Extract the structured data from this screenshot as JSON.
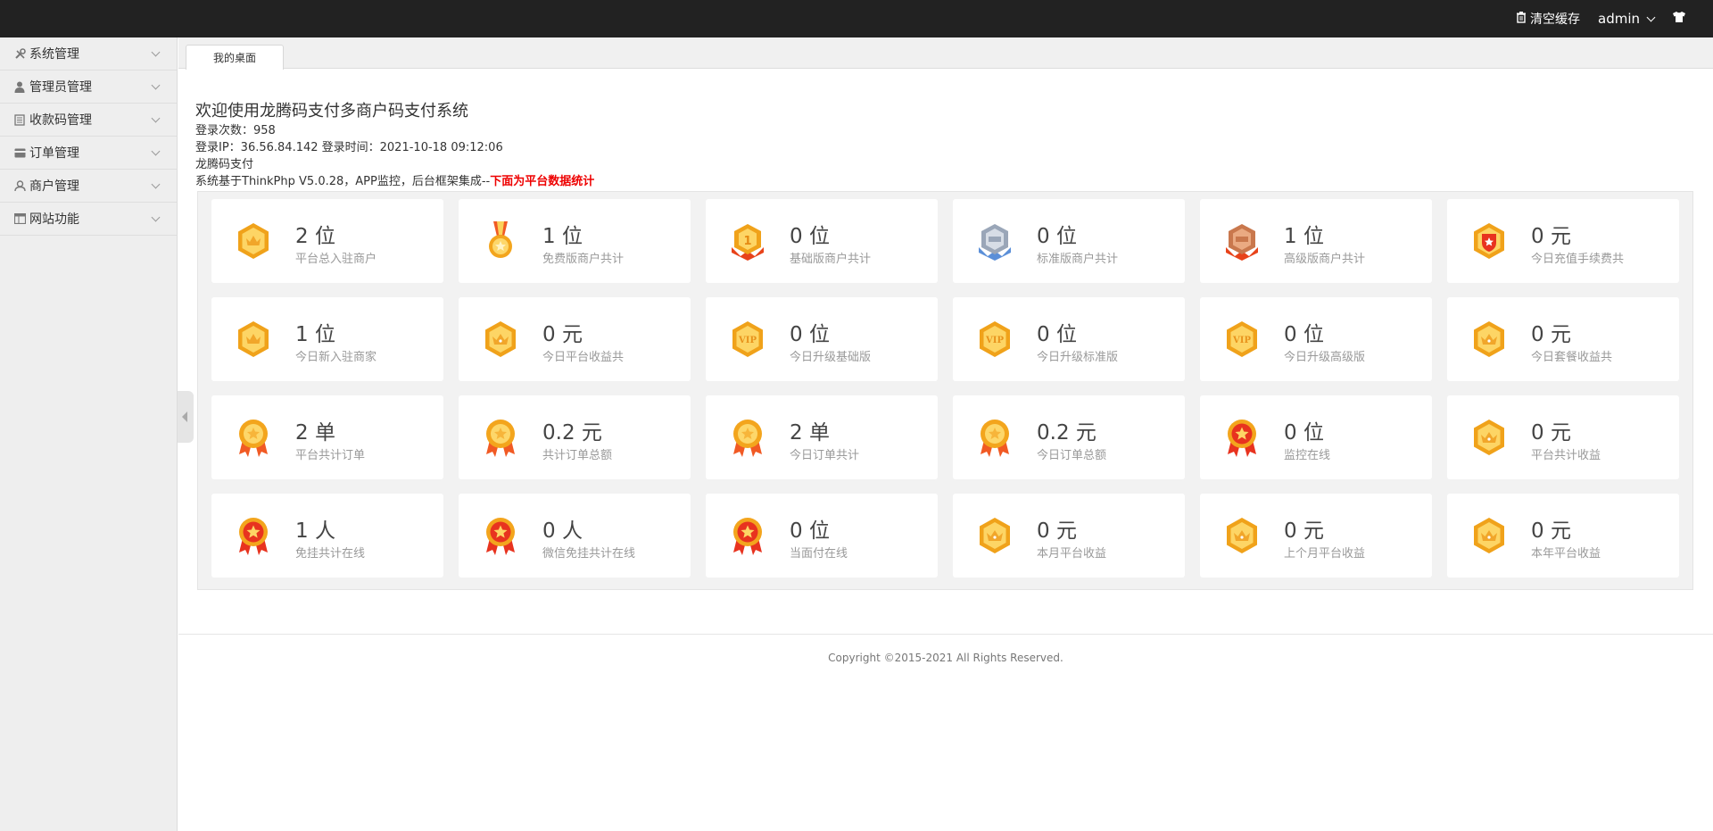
{
  "topbar": {
    "clear_cache_label": "清空缓存",
    "user_label": "admin"
  },
  "sidebar": {
    "items": [
      {
        "label": "系统管理",
        "icon": "wrench-icon"
      },
      {
        "label": "管理员管理",
        "icon": "user-icon"
      },
      {
        "label": "收款码管理",
        "icon": "document-icon"
      },
      {
        "label": "订单管理",
        "icon": "card-icon"
      },
      {
        "label": "商户管理",
        "icon": "merchant-icon"
      },
      {
        "label": "网站功能",
        "icon": "window-icon"
      }
    ]
  },
  "tabs": [
    {
      "label": "我的桌面"
    }
  ],
  "welcome": {
    "title": "欢迎使用龙腾码支付多商户码支付系统",
    "login_count": "登录次数：958",
    "login_info": "登录IP：36.56.84.142 登录时间：2021-10-18 09:12:06",
    "brand": "龙腾码支付",
    "framework_prefix": "系统基于ThinkPhp V5.0.28，APP监控，后台框架集成--",
    "framework_highlight": "下面为平台数据统计"
  },
  "stats": [
    {
      "value": "2 位",
      "label": "平台总入驻商户",
      "icon": "gold-hexagon-medal-icon"
    },
    {
      "value": "1 位",
      "label": "免费版商户共计",
      "icon": "ribbon-medal-icon"
    },
    {
      "value": "0 位",
      "label": "基础版商户共计",
      "icon": "gold-rank-badge-icon"
    },
    {
      "value": "0 位",
      "label": "标准版商户共计",
      "icon": "silver-rank-badge-icon"
    },
    {
      "value": "1 位",
      "label": "高级版商户共计",
      "icon": "bronze-rank-badge-icon"
    },
    {
      "value": "0 元",
      "label": "今日充值手续费共",
      "icon": "red-shield-medal-icon"
    },
    {
      "value": "1 位",
      "label": "今日新入驻商家",
      "icon": "gold-hexagon-medal-icon"
    },
    {
      "value": "0 元",
      "label": "今日平台收益共",
      "icon": "crown-hexagon-medal-icon"
    },
    {
      "value": "0 位",
      "label": "今日升级基础版",
      "icon": "vip-hexagon-icon"
    },
    {
      "value": "0 位",
      "label": "今日升级标准版",
      "icon": "vip-hexagon-icon"
    },
    {
      "value": "0 位",
      "label": "今日升级高级版",
      "icon": "vip-hexagon-icon"
    },
    {
      "value": "0 元",
      "label": "今日套餐收益共",
      "icon": "crown-hexagon-medal-icon"
    },
    {
      "value": "2 单",
      "label": "平台共计订单",
      "icon": "gold-rosette-icon"
    },
    {
      "value": "0.2 元",
      "label": "共计订单总额",
      "icon": "gold-rosette-icon"
    },
    {
      "value": "2 单",
      "label": "今日订单共计",
      "icon": "gold-rosette-icon"
    },
    {
      "value": "0.2 元",
      "label": "今日订单总额",
      "icon": "gold-rosette-icon"
    },
    {
      "value": "0 位",
      "label": "监控在线",
      "icon": "red-star-rosette-icon"
    },
    {
      "value": "0 元",
      "label": "平台共计收益",
      "icon": "crown-hexagon-medal-icon"
    },
    {
      "value": "1 人",
      "label": "免挂共计在线",
      "icon": "red-star-rosette-icon"
    },
    {
      "value": "0 人",
      "label": "微信免挂共计在线",
      "icon": "red-star-rosette-icon"
    },
    {
      "value": "0 位",
      "label": "当面付在线",
      "icon": "red-star-rosette-icon"
    },
    {
      "value": "0 元",
      "label": "本月平台收益",
      "icon": "crown-hexagon-medal-icon"
    },
    {
      "value": "0 元",
      "label": "上个月平台收益",
      "icon": "crown-hexagon-medal-icon"
    },
    {
      "value": "0 元",
      "label": "本年平台收益",
      "icon": "crown-hexagon-medal-icon"
    }
  ],
  "footer": {
    "copyright": "Copyright ©2015-2021 All Rights Reserved."
  }
}
